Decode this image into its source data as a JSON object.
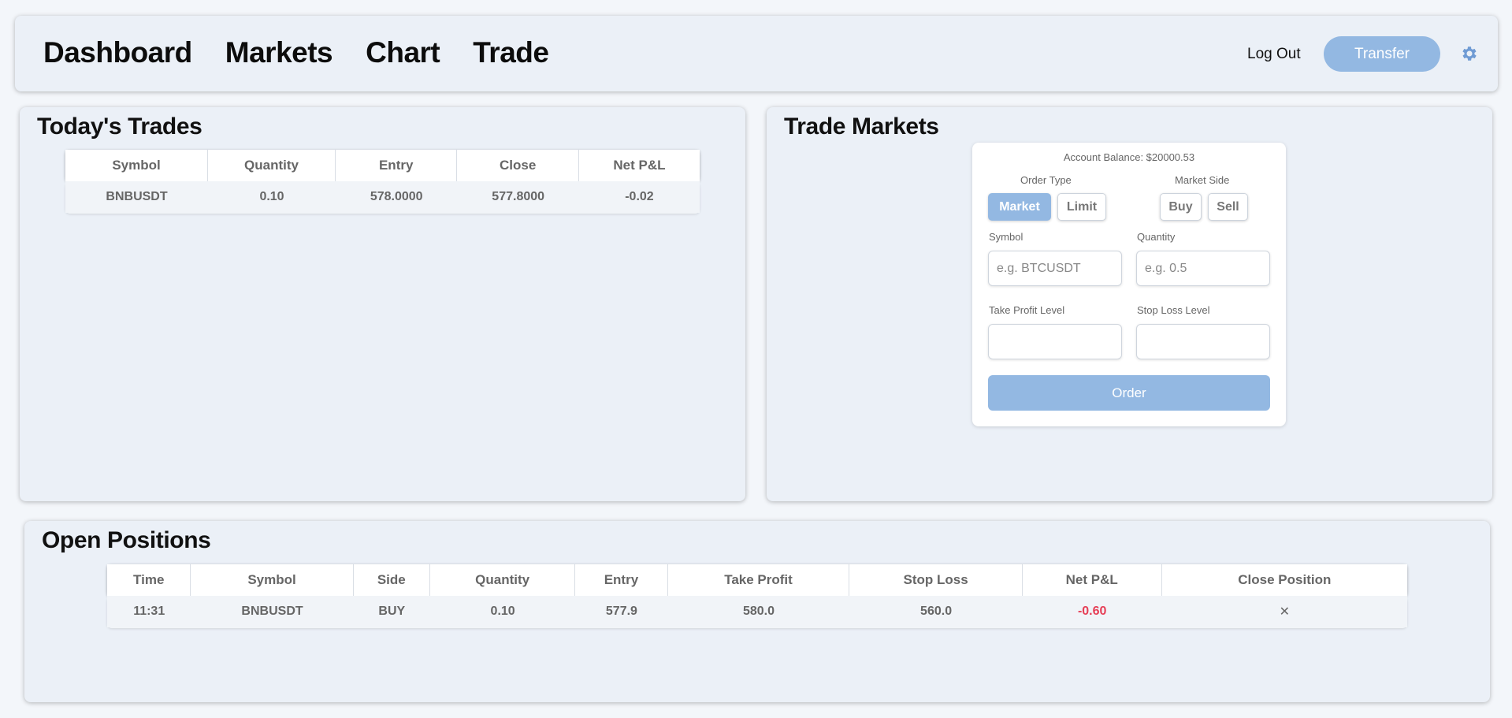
{
  "nav": {
    "dashboard": "Dashboard",
    "markets": "Markets",
    "chart": "Chart",
    "trade": "Trade",
    "logout": "Log Out",
    "transfer": "Transfer"
  },
  "colors": {
    "accent": "#93b8e2",
    "negative": "#e63e56",
    "panel": "#ebf0f7"
  },
  "trades": {
    "title": "Today's Trades",
    "columns": [
      "Symbol",
      "Quantity",
      "Entry",
      "Close",
      "Net P&L"
    ],
    "rows": [
      [
        "BNBUSDT",
        "0.10",
        "578.0000",
        "577.8000",
        "-0.02"
      ]
    ]
  },
  "markets": {
    "title": "Trade Markets",
    "balance": "Account Balance: $20000.53",
    "order_type_label": "Order Type",
    "order_type_market": "Market",
    "order_type_limit": "Limit",
    "market_side_label": "Market Side",
    "side_buy": "Buy",
    "side_sell": "Sell",
    "symbol_label": "Symbol",
    "symbol_placeholder": "e.g. BTCUSDT",
    "quantity_label": "Quantity",
    "quantity_placeholder": "e.g. 0.5",
    "tp_label": "Take Profit Level",
    "sl_label": "Stop Loss Level",
    "order_button": "Order"
  },
  "positions": {
    "title": "Open Positions",
    "columns": [
      "Time",
      "Symbol",
      "Side",
      "Quantity",
      "Entry",
      "Take Profit",
      "Stop Loss",
      "Net P&L",
      "Close Position"
    ],
    "rows": [
      [
        "11:31",
        "BNBUSDT",
        "BUY",
        "0.10",
        "577.9",
        "580.0",
        "560.0",
        "-0.60",
        "✕"
      ]
    ]
  }
}
